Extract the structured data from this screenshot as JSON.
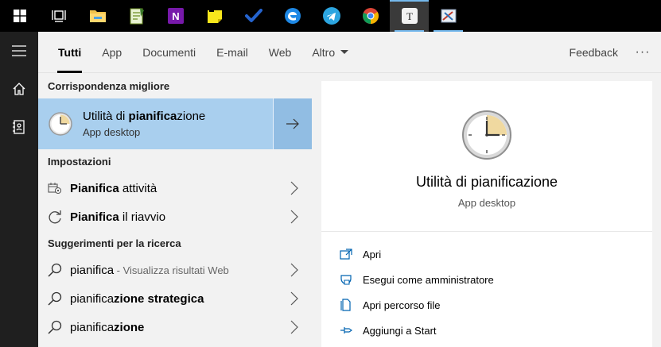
{
  "taskbar": {
    "items": [
      {
        "name": "start-icon"
      },
      {
        "name": "task-view-icon"
      },
      {
        "name": "file-explorer-icon"
      },
      {
        "name": "notepad-plus-icon"
      },
      {
        "name": "onenote-icon"
      },
      {
        "name": "sticky-notes-icon"
      },
      {
        "name": "todo-icon"
      },
      {
        "name": "edge-icon"
      },
      {
        "name": "telegram-icon"
      },
      {
        "name": "chrome-icon"
      },
      {
        "name": "typora-icon",
        "letter": "T"
      },
      {
        "name": "snipping-tool-icon"
      }
    ]
  },
  "rail": {
    "items": [
      "menu-icon",
      "home-icon",
      "notebook-icon"
    ]
  },
  "tabs": {
    "items": [
      "Tutti",
      "App",
      "Documenti",
      "E-mail",
      "Web",
      "Altro"
    ],
    "selected": "Tutti",
    "feedback": "Feedback",
    "more": "···"
  },
  "best_match": {
    "heading": "Corrispondenza migliore",
    "title_pre": "Utilità di ",
    "title_bold": "pianifica",
    "title_post": "zione",
    "subtitle": "App desktop"
  },
  "settings": {
    "heading": "Impostazioni",
    "items": [
      {
        "bold": "Pianifica",
        "rest": " attività",
        "icon": "task-scheduler-gear-icon"
      },
      {
        "bold": "Pianifica",
        "rest": " il riavvio",
        "icon": "restart-icon"
      }
    ]
  },
  "suggestions": {
    "heading": "Suggerimenti per la ricerca",
    "items": [
      {
        "normal": "pianifica",
        "bold": "",
        "dim": " - Visualizza risultati Web"
      },
      {
        "normal": "pianifica",
        "bold": "zione strategica",
        "dim": ""
      },
      {
        "normal": "pianifica",
        "bold": "zione",
        "dim": ""
      }
    ]
  },
  "preview": {
    "title": "Utilità di pianificazione",
    "subtitle": "App desktop",
    "actions": [
      {
        "label": "Apri",
        "icon": "open-icon"
      },
      {
        "label": "Esegui come amministratore",
        "icon": "shield-icon"
      },
      {
        "label": "Apri percorso file",
        "icon": "file-location-icon"
      },
      {
        "label": "Aggiungi a Start",
        "icon": "pin-icon"
      }
    ]
  },
  "colors": {
    "accent": "#0063b1",
    "best_bg": "#a9cfee",
    "best_arrow_bg": "#91bde3"
  }
}
